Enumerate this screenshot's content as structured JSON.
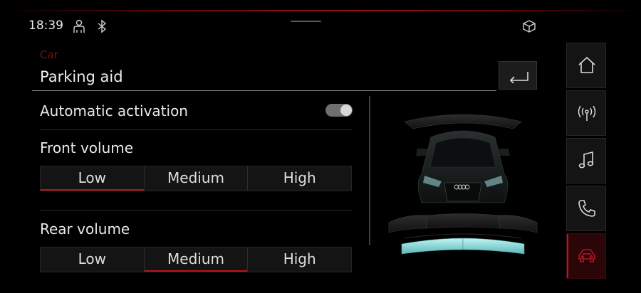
{
  "status_bar": {
    "time": "18:39",
    "icons": [
      "user-profile-icon",
      "bluetooth-icon",
      "package-cube-icon"
    ]
  },
  "page": {
    "breadcrumb": "Car",
    "title": "Parking aid"
  },
  "settings": {
    "automatic_activation": {
      "label": "Automatic activation",
      "enabled": true
    },
    "front_volume": {
      "label": "Front volume",
      "options": [
        "Low",
        "Medium",
        "High"
      ],
      "selected": "Low"
    },
    "rear_volume": {
      "label": "Rear volume",
      "options": [
        "Low",
        "Medium",
        "High"
      ],
      "selected": "Medium"
    }
  },
  "sidebar": {
    "items": [
      {
        "icon": "home-icon",
        "active": false
      },
      {
        "icon": "radio-antenna-icon",
        "active": false
      },
      {
        "icon": "music-note-icon",
        "active": false
      },
      {
        "icon": "phone-icon",
        "active": false
      },
      {
        "icon": "car-icon",
        "active": true
      }
    ]
  },
  "colors": {
    "accent": "#b3141d",
    "sensor_active": "#7fd8d8",
    "breadcrumb": "#7a1015",
    "background": "#000000"
  }
}
